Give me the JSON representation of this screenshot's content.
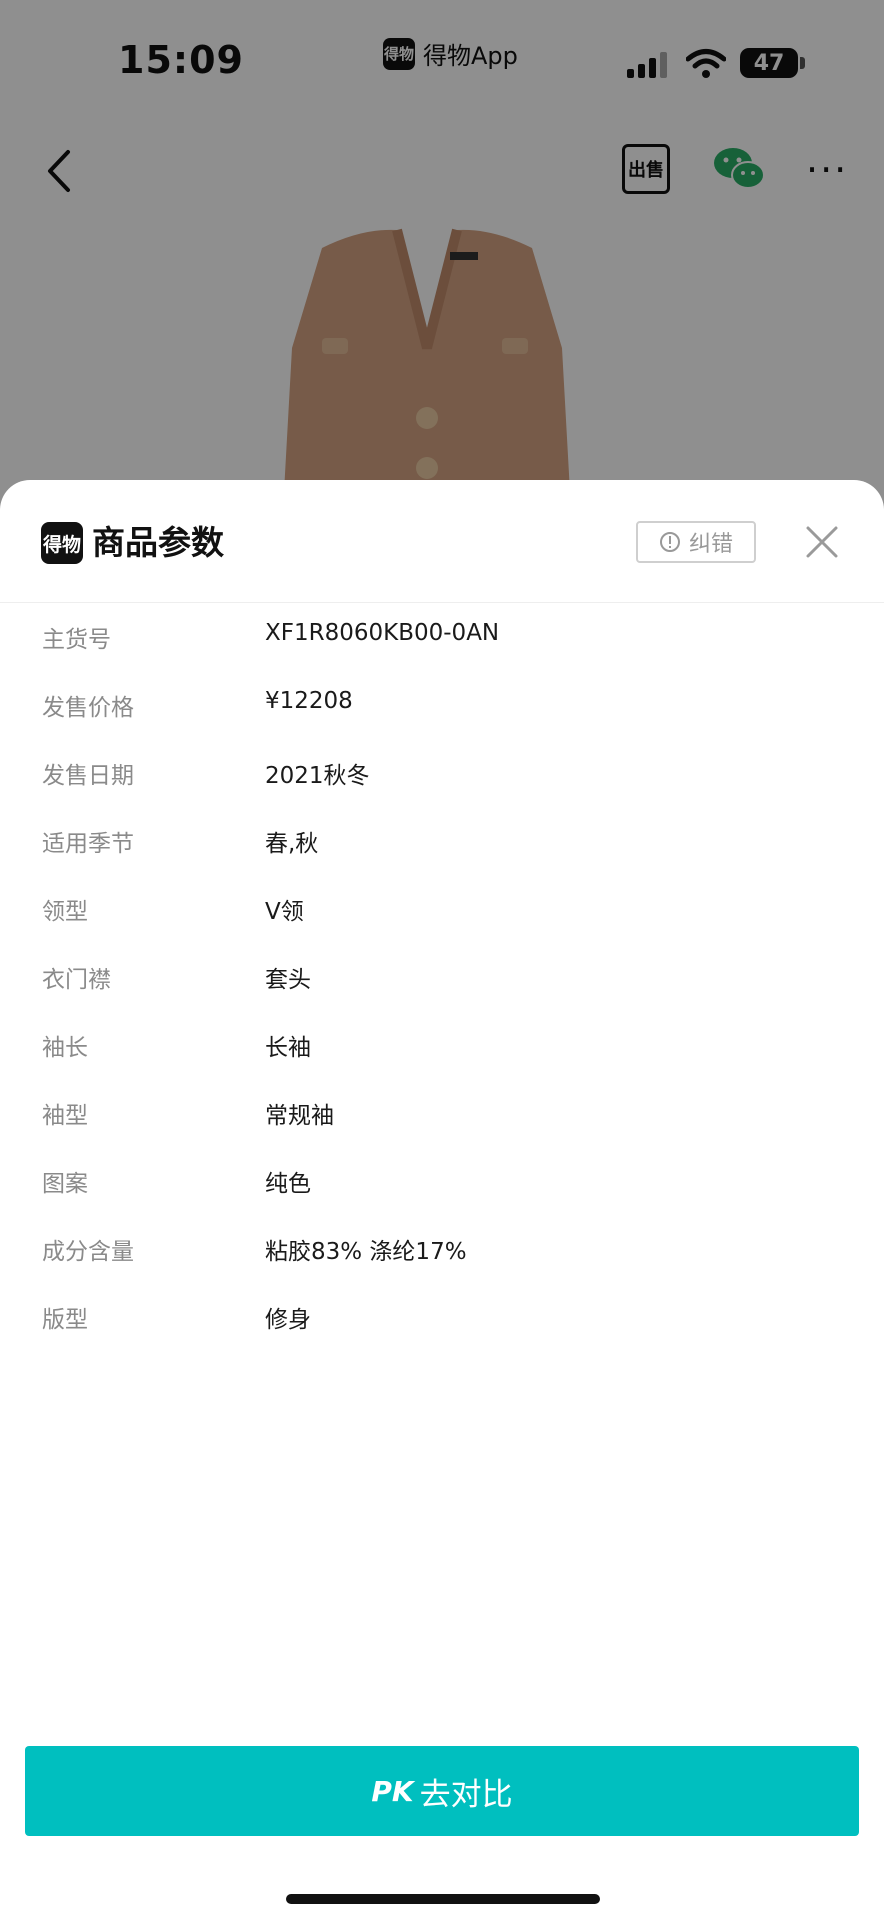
{
  "status_bar": {
    "time": "15:09",
    "app_name": "得物App",
    "app_logo_text": "得物",
    "battery": "47"
  },
  "nav": {
    "sell_label": "出售"
  },
  "sheet": {
    "logo_text": "得物",
    "title": "商品参数",
    "report_label": "纠错",
    "params": [
      {
        "key": "主货号",
        "value": "XF1R8060KB00-0AN"
      },
      {
        "key": "发售价格",
        "value": "¥12208"
      },
      {
        "key": "发售日期",
        "value": "2021秋冬"
      },
      {
        "key": "适用季节",
        "value": "春,秋"
      },
      {
        "key": "领型",
        "value": "V领"
      },
      {
        "key": "衣门襟",
        "value": "套头"
      },
      {
        "key": "袖长",
        "value": "长袖"
      },
      {
        "key": "袖型",
        "value": "常规袖"
      },
      {
        "key": "图案",
        "value": "纯色"
      },
      {
        "key": "成分含量",
        "value": "粘胶83% 涤纶17%"
      },
      {
        "key": "版型",
        "value": "修身"
      }
    ],
    "pk_tag": "PK",
    "pk_label": "去对比"
  },
  "colors": {
    "accent": "#00bfbf",
    "wechat": "#2aae67"
  }
}
